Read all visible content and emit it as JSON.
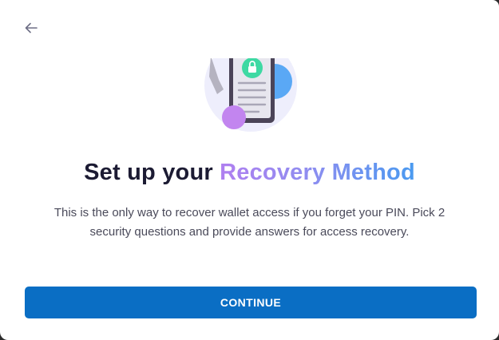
{
  "header": {
    "back_icon": "arrow-left-icon"
  },
  "illustration": {
    "icon": "phone-lock-icon",
    "colors": {
      "circle_bg": "#eeeefc",
      "phone": "#4b4458",
      "lock_badge": "#3ed9a3",
      "blue_blob": "#5aa8f5",
      "purple_blob": "#c285ef"
    }
  },
  "title": {
    "prefix": "Set up your",
    "highlight": "Recovery Method"
  },
  "description": "This is the only way to recover wallet access if you forget your PIN. Pick 2 security questions and provide answers for access recovery.",
  "actions": {
    "continue_label": "CONTINUE"
  },
  "colors": {
    "primary": "#0a6ec4",
    "title_text": "#1c1b33",
    "body_text": "#4a4a5a",
    "gradient_start": "#b07ff0",
    "gradient_end": "#4a9af0"
  }
}
